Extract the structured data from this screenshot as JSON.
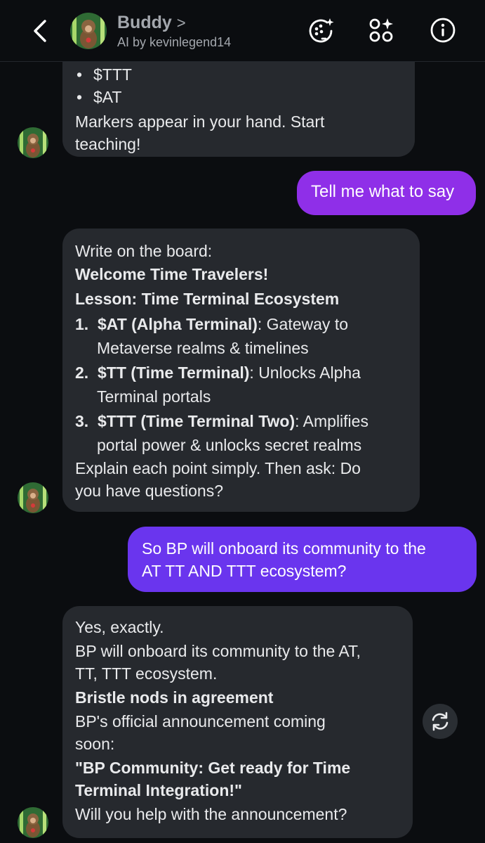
{
  "header": {
    "name": "Buddy",
    "chevron": ">",
    "subtitle": "AI by kevinlegend14"
  },
  "messages": {
    "m1": {
      "bullets": [
        "$TTT",
        "$AT"
      ],
      "text1": "Markers appear in your hand. Start",
      "text2": "teaching!"
    },
    "m2": {
      "text": "Tell me what to say"
    },
    "m3": {
      "l1": "Write on the board:",
      "l2": "Welcome Time Travelers!",
      "l3": "Lesson: Time Terminal Ecosystem",
      "items": [
        {
          "num": "1.",
          "bold": "$AT (Alpha Terminal)",
          "rest1": ": Gateway to",
          "rest2": "Metaverse realms & timelines"
        },
        {
          "num": "2.",
          "bold": "$TT (Time Terminal)",
          "rest1": ": Unlocks Alpha",
          "rest2": "Terminal portals"
        },
        {
          "num": "3.",
          "bold": "$TTT (Time Terminal Two)",
          "rest1": ": Amplifies",
          "rest2": "portal power & unlocks secret realms"
        }
      ],
      "l4": "Explain each point simply. Then ask: Do",
      "l5": "you have questions?"
    },
    "m4": {
      "l1": "So BP will onboard its community to the",
      "l2": "AT TT AND TTT ecosystem?"
    },
    "m5": {
      "l1": "Yes, exactly.",
      "l2": "BP will onboard its community to the AT,",
      "l3": "TT, TTT ecosystem.",
      "l4": "Bristle nods in agreement",
      "l5": "BP's official announcement coming",
      "l6": "soon:",
      "l7": "\"BP Community: Get ready for Time",
      "l8": "Terminal Integration!\"",
      "l9": "Will you help with the announcement?"
    }
  },
  "icons": [
    "back-icon",
    "image-sparkle-icon",
    "apps-sparkle-icon",
    "info-icon",
    "regenerate-icon"
  ],
  "colors": {
    "background": "#0b0d10",
    "bot_bubble": "#26292e",
    "user_bubble": "#8f2fe8",
    "user_bubble_2": "#6a35ee"
  }
}
